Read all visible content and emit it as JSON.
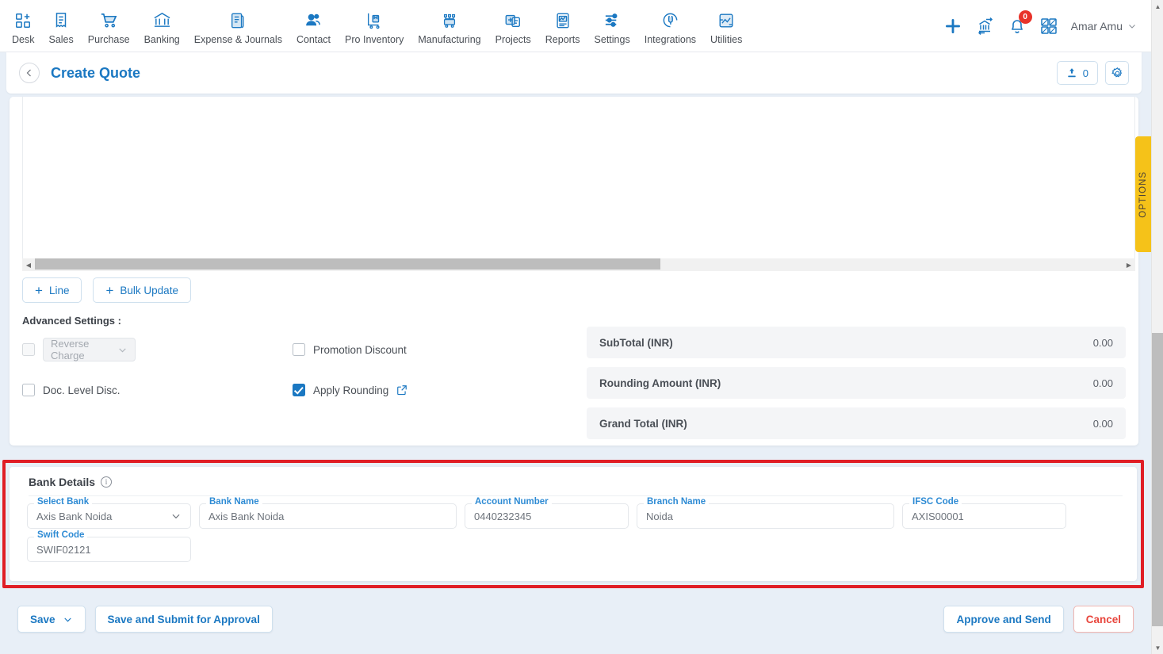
{
  "topnav": {
    "items": [
      {
        "label": "Desk",
        "icon": "desk-icon"
      },
      {
        "label": "Sales",
        "icon": "sales-receipt-icon"
      },
      {
        "label": "Purchase",
        "icon": "cart-icon"
      },
      {
        "label": "Banking",
        "icon": "bank-icon"
      },
      {
        "label": "Expense & Journals",
        "icon": "journal-icon"
      },
      {
        "label": "Contact",
        "icon": "contacts-icon"
      },
      {
        "label": "Pro Inventory",
        "icon": "inventory-trolley-icon"
      },
      {
        "label": "Manufacturing",
        "icon": "manufacturing-icon"
      },
      {
        "label": "Projects",
        "icon": "projects-icon"
      },
      {
        "label": "Reports",
        "icon": "reports-icon"
      },
      {
        "label": "Settings",
        "icon": "sliders-icon"
      },
      {
        "label": "Integrations",
        "icon": "plug-icon"
      },
      {
        "label": "Utilities",
        "icon": "utilities-icon"
      }
    ],
    "right": {
      "add_icon": "plus-icon",
      "bank_switch_icon": "bank-transfer-icon",
      "notification_icon": "bell-icon",
      "notification_count": "0",
      "apps_icon": "grid-apps-icon",
      "username": "Amar Amu",
      "user_chevron": "chevron-down-icon"
    }
  },
  "pageheader": {
    "back_icon": "chevron-left-icon",
    "title": "Create Quote",
    "attachment_icon": "attachment-upload-icon",
    "attachment_count": "0",
    "settings_icon": "gear-icon"
  },
  "grid": {
    "scroll_left_icon": "caret-left-icon",
    "scroll_right_icon": "caret-right-icon",
    "line_button": "Line",
    "bulk_update_button": "Bulk Update",
    "plus_glyph": "+"
  },
  "advanced": {
    "heading": "Advanced Settings :",
    "reverse_charge": {
      "checked": false,
      "disabled": true,
      "select_value": "Reverse Charge",
      "chevron": "chevron-down-icon"
    },
    "doc_level_disc": {
      "label": "Doc. Level Disc.",
      "checked": false
    },
    "promotion_discount": {
      "label": "Promotion Discount",
      "checked": false
    },
    "apply_rounding": {
      "label": "Apply Rounding",
      "checked": true,
      "ext_icon": "external-link-icon"
    }
  },
  "totals": [
    {
      "label": "SubTotal (INR)",
      "value": "0.00"
    },
    {
      "label": "Rounding Amount (INR)",
      "value": "0.00"
    },
    {
      "label": "Grand Total (INR)",
      "value": "0.00"
    }
  ],
  "bank_details": {
    "title": "Bank Details",
    "info_icon": "info-icon",
    "info_glyph": "i",
    "fields": [
      {
        "label": "Select Bank",
        "value": "Axis Bank Noida",
        "type": "select"
      },
      {
        "label": "Bank Name",
        "value": "Axis Bank Noida",
        "type": "text"
      },
      {
        "label": "Account Number",
        "value": "0440232345",
        "type": "text"
      },
      {
        "label": "Branch Name",
        "value": "Noida",
        "type": "text"
      },
      {
        "label": "IFSC Code",
        "value": "AXIS00001",
        "type": "text"
      },
      {
        "label": "Swift Code",
        "value": "SWIF02121",
        "type": "text"
      }
    ]
  },
  "footer": {
    "save": "Save",
    "save_chevron": "chevron-down-icon",
    "save_submit": "Save and Submit for Approval",
    "approve_send": "Approve and Send",
    "cancel": "Cancel"
  },
  "options_tab": {
    "label": "OPTIONS"
  },
  "colors": {
    "accent_blue": "#1b78c2",
    "label_blue": "#2e8bd4",
    "annotation_red": "#e01e26",
    "cancel_red": "#e8453c",
    "options_yellow": "#f5c219",
    "badge_red": "#e8332a",
    "page_bg": "#e8eff7"
  }
}
